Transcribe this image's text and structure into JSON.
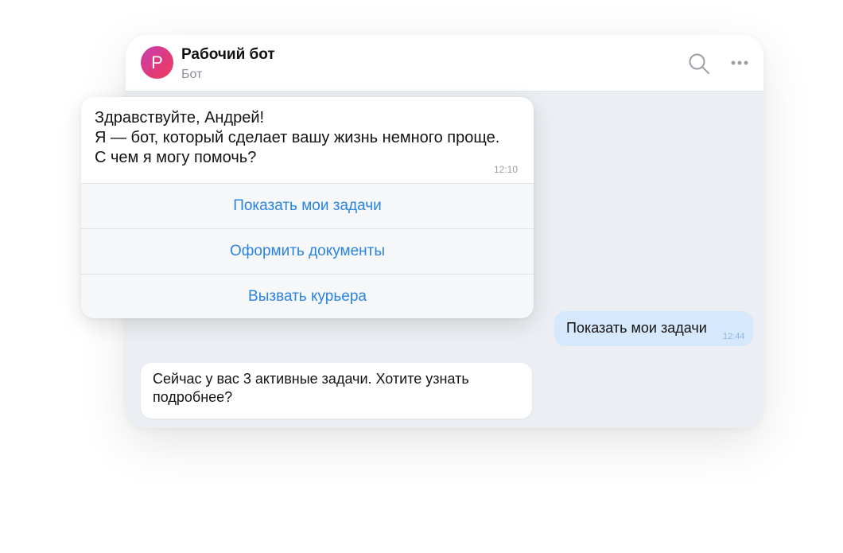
{
  "chat": {
    "avatar_letter": "Р",
    "title": "Рабочий бот",
    "subtitle": "Бот",
    "icons": [
      "search-icon",
      "more-icon"
    ]
  },
  "welcome": {
    "lines": [
      "Здравствуйте, Андрей!",
      "Я — бот, который сделает вашу жизнь немного проще.",
      "С чем я могу помочь?"
    ],
    "time": "12:10",
    "buttons": [
      "Показать мои задачи",
      "Оформить документы",
      "Вызвать курьера"
    ]
  },
  "outgoing": {
    "text": "Показать мои задачи",
    "time": "12:44"
  },
  "reply": {
    "text": "Сейчас у вас 3 активные задачи. Хотите узнать подробнее?"
  },
  "colors": {
    "accent": "#2a84e0",
    "outgoing_bubble": "#d6e8fb",
    "chat_background": "#ebeef2"
  }
}
